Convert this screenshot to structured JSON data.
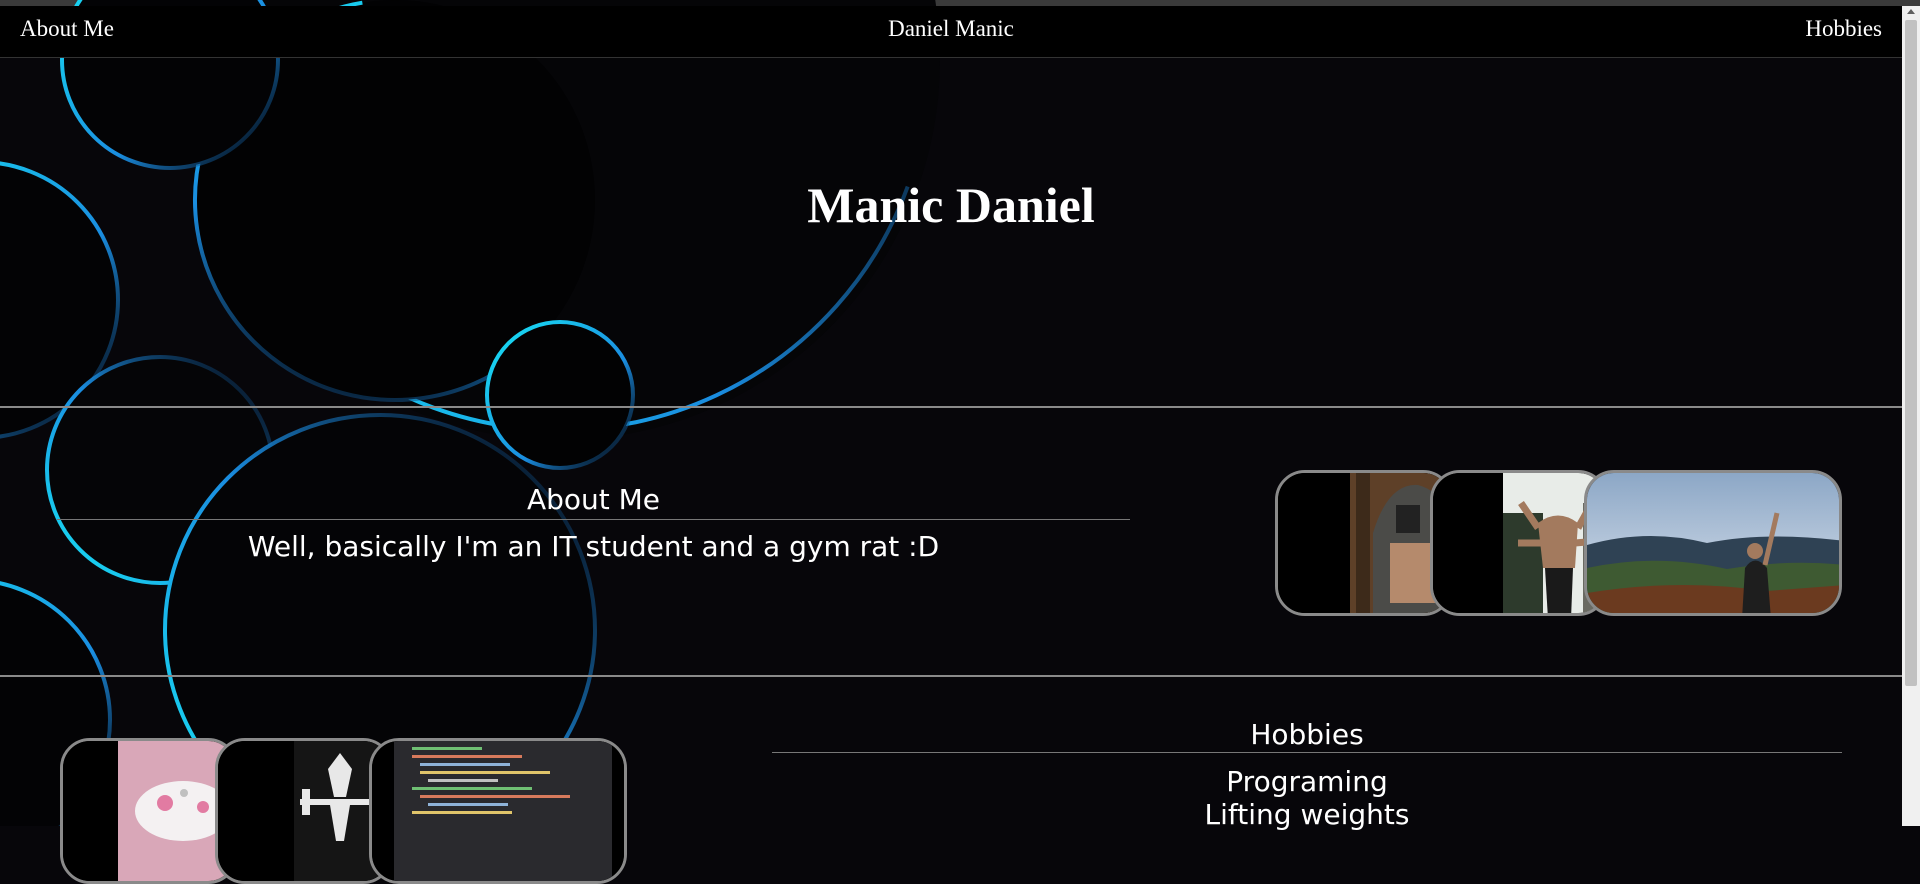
{
  "nav": {
    "left_label": "About Me",
    "center_label": "Daniel Manic",
    "right_label": "Hobbies"
  },
  "hero": {
    "title": "Manic Daniel"
  },
  "about": {
    "heading": "About Me",
    "text": "Well, basically I'm an IT student and a gym rat :D",
    "photos": [
      "hoodie-mirror-selfie-photo",
      "multi-arm-gym-photo",
      "mountain-landscape-photo"
    ]
  },
  "hobbies": {
    "heading": "Hobbies",
    "items": [
      "Programing",
      "Lifting weights"
    ],
    "photos": [
      "gamepad-controller-photo",
      "weightlifting-logo-photo",
      "code-screen-photo"
    ]
  },
  "colors": {
    "background": "#07060a",
    "accent_cyan": "#18e6f5",
    "accent_blue": "#1a8de0",
    "divider": "#8a8a8a"
  }
}
